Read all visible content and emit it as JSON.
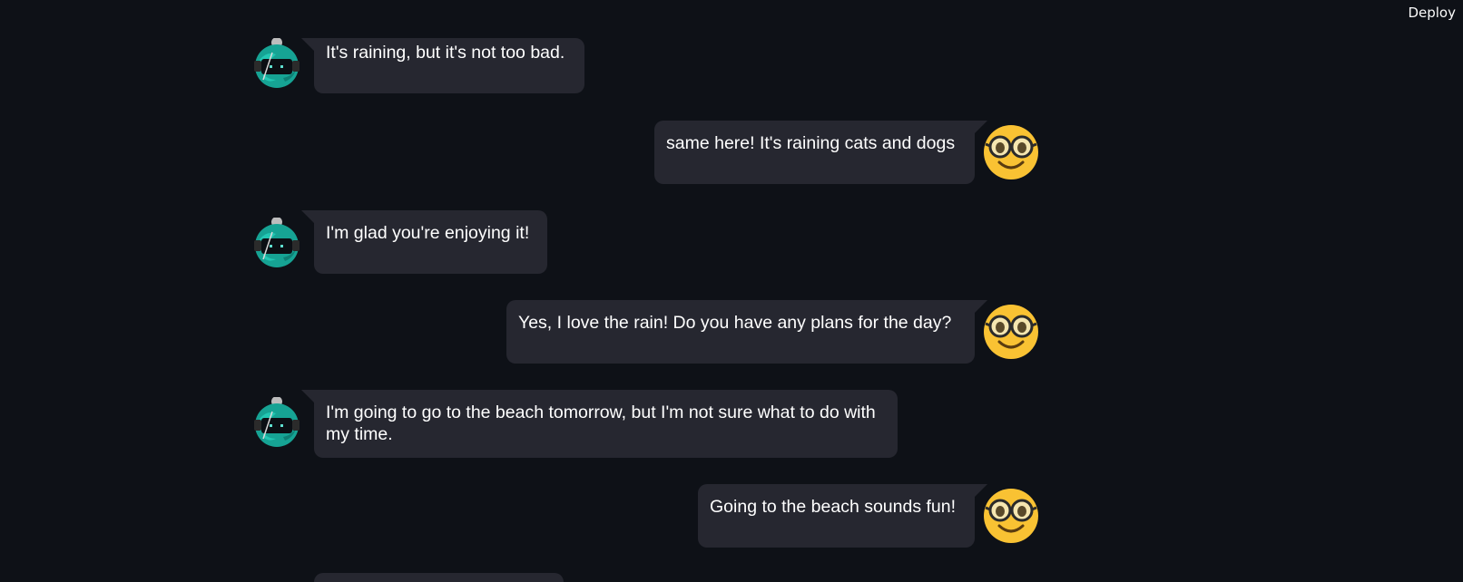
{
  "toolbar": {
    "deploy_label": "Deploy"
  },
  "messages": [
    {
      "role": "bot",
      "text": "It's raining, but it's not too bad.",
      "avatar_icon": "robot-icon"
    },
    {
      "role": "user",
      "text": "same here! It's raining cats and dogs",
      "avatar_icon": "nerd-face-icon"
    },
    {
      "role": "bot",
      "text": "I'm glad you're enjoying it!",
      "avatar_icon": "robot-icon"
    },
    {
      "role": "user",
      "text": "Yes, I love the rain! Do you have any plans for the day?",
      "avatar_icon": "nerd-face-icon"
    },
    {
      "role": "bot",
      "text": "I'm going to go to the beach tomorrow, but I'm not sure what to do with my time.",
      "avatar_icon": "robot-icon"
    },
    {
      "role": "user",
      "text": "Going to the beach sounds fun!",
      "avatar_icon": "nerd-face-icon"
    }
  ],
  "colors": {
    "background": "#0e1117",
    "bubble": "#262730",
    "text": "#ffffff",
    "robot_teal": "#1aa89a",
    "nerd_yellow": "#f9c233"
  }
}
